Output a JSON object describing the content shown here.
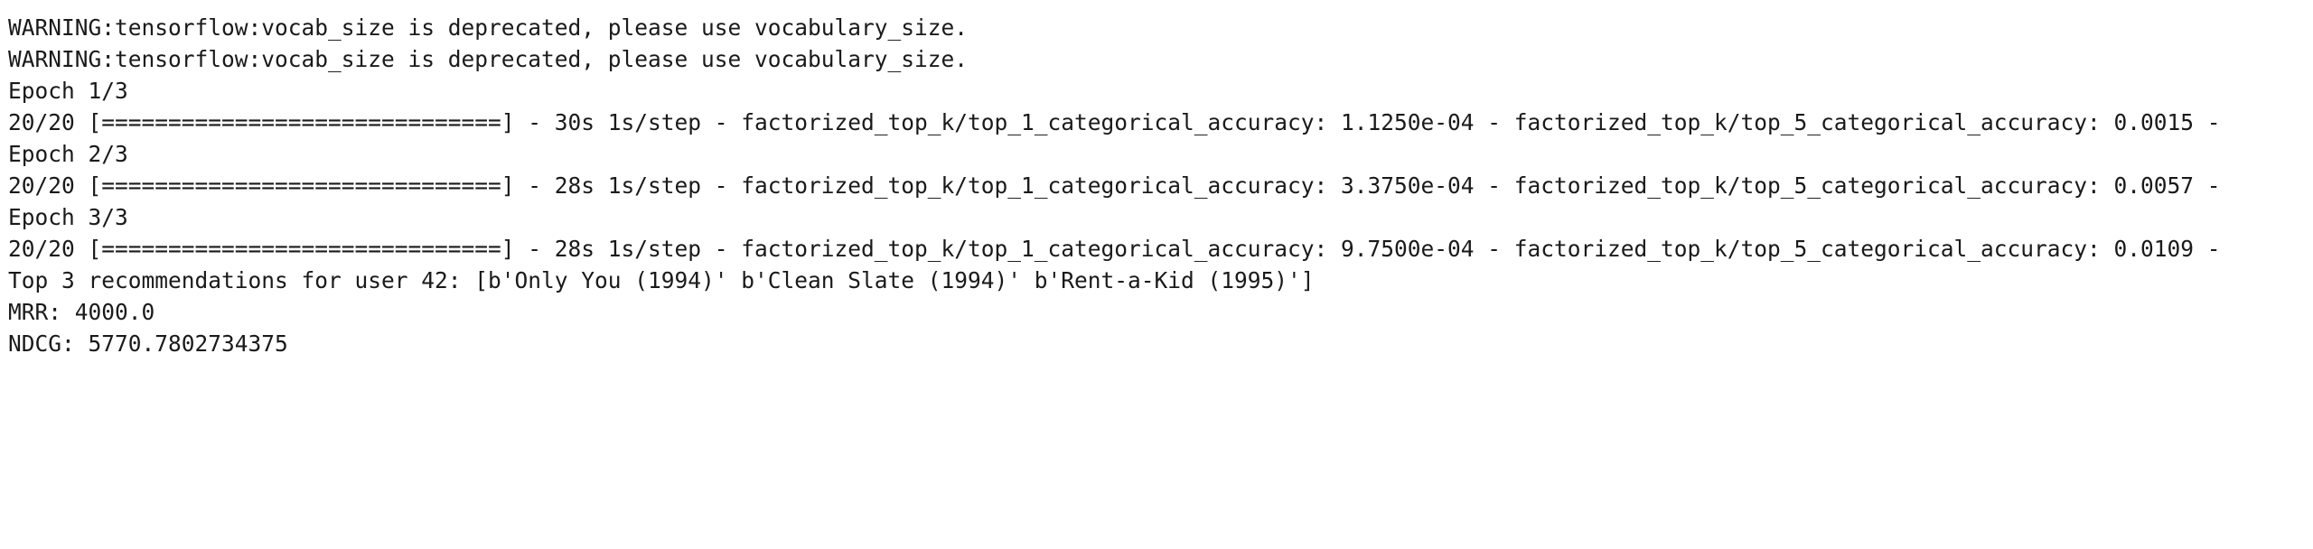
{
  "output": {
    "lines": [
      "WARNING:tensorflow:vocab_size is deprecated, please use vocabulary_size.",
      "WARNING:tensorflow:vocab_size is deprecated, please use vocabulary_size.",
      "Epoch 1/3",
      "20/20 [==============================] - 30s 1s/step - factorized_top_k/top_1_categorical_accuracy: 1.1250e-04 - factorized_top_k/top_5_categorical_accuracy: 0.0015 -",
      "Epoch 2/3",
      "20/20 [==============================] - 28s 1s/step - factorized_top_k/top_1_categorical_accuracy: 3.3750e-04 - factorized_top_k/top_5_categorical_accuracy: 0.0057 -",
      "Epoch 3/3",
      "20/20 [==============================] - 28s 1s/step - factorized_top_k/top_1_categorical_accuracy: 9.7500e-04 - factorized_top_k/top_5_categorical_accuracy: 0.0109 -",
      "Top 3 recommendations for user 42: [b'Only You (1994)' b'Clean Slate (1994)' b'Rent-a-Kid (1995)']",
      "MRR: 4000.0",
      "NDCG: 5770.7802734375"
    ]
  }
}
